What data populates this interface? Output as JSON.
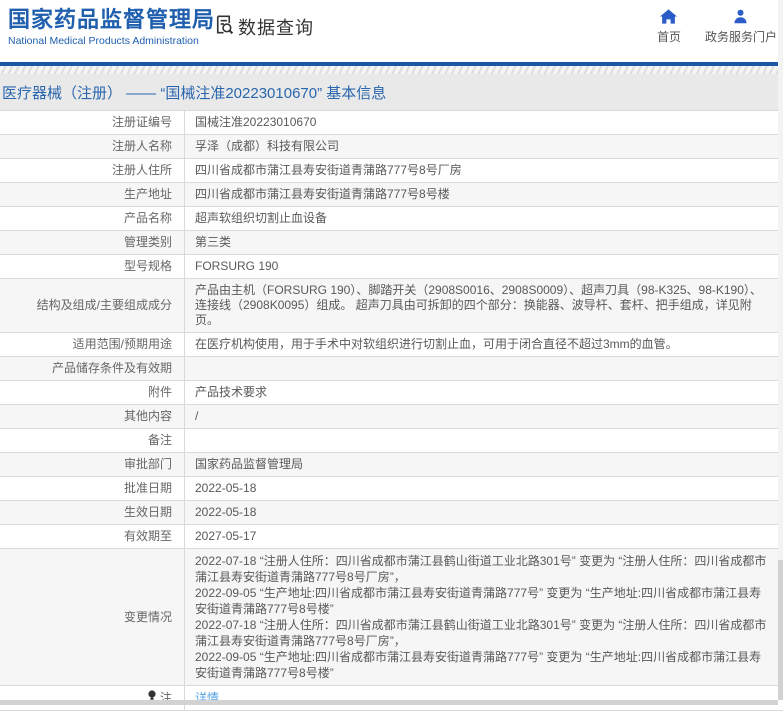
{
  "header": {
    "org_name": "国家药品监督管理局",
    "org_name_en": "National Medical Products Administration",
    "app_title": "数据查询",
    "nav": [
      {
        "label": "首页",
        "icon": "home-icon"
      },
      {
        "label": "政务服务门户",
        "icon": "user-icon"
      }
    ]
  },
  "breadcrumb": "医疗器械（注册） —— “国械注准20223010670” 基本信息",
  "colors": {
    "brand_blue": "#1f5fae",
    "bar_blue": "#1c57a5",
    "nav_icon_blue": "#2b5cc8",
    "link_blue": "#55a2e6",
    "breadcrumb_text": "#2a66ad"
  },
  "table": {
    "rows": [
      {
        "label": "注册证编号",
        "value": "国械注准20223010670"
      },
      {
        "label": "注册人名称",
        "value": "孚泽（成都）科技有限公司"
      },
      {
        "label": "注册人住所",
        "value": "四川省成都市蒲江县寿安街道青蒲路777号8号厂房"
      },
      {
        "label": "生产地址",
        "value": "四川省成都市蒲江县寿安街道青蒲路777号8号楼"
      },
      {
        "label": "产品名称",
        "value": "超声软组织切割止血设备"
      },
      {
        "label": "管理类别",
        "value": "第三类"
      },
      {
        "label": "型号规格",
        "value": "FORSURG 190"
      },
      {
        "label": "结构及组成/主要组成成分",
        "value": "产品由主机（FORSURG 190）、脚踏开关（2908S0016、2908S0009）、超声刀具（98-K325、98-K190）、连接线（2908K0095）组成。 超声刀具由可拆卸的四个部分：换能器、波导杆、套杆、把手组成，详见附页。"
      },
      {
        "label": "适用范围/预期用途",
        "value": "在医疗机构使用，用于手术中对软组织进行切割止血，可用于闭合直径不超过3mm的血管。"
      },
      {
        "label": "产品储存条件及有效期",
        "value": ""
      },
      {
        "label": "附件",
        "value": "产品技术要求"
      },
      {
        "label": "其他内容",
        "value": "/"
      },
      {
        "label": "备注",
        "value": ""
      },
      {
        "label": "审批部门",
        "value": "国家药品监督管理局"
      },
      {
        "label": "批准日期",
        "value": "2022-05-18"
      },
      {
        "label": "生效日期",
        "value": "2022-05-18"
      },
      {
        "label": "有效期至",
        "value": "2027-05-17"
      },
      {
        "label": "变更情况",
        "lines": [
          "2022-07-18 “注册人住所：四川省成都市蒲江县鹤山街道工业北路301号” 变更为 “注册人住所：四川省成都市蒲江县寿安街道青蒲路777号8号厂房”，",
          "2022-09-05 “生产地址:四川省成都市蒲江县寿安街道青蒲路777号” 变更为 “生产地址:四川省成都市蒲江县寿安街道青蒲路777号8号楼”",
          "2022-07-18 “注册人住所：四川省成都市蒲江县鹤山街道工业北路301号” 变更为 “注册人住所：四川省成都市蒲江县寿安街道青蒲路777号8号厂房”，",
          "2022-09-05 “生产地址:四川省成都市蒲江县寿安街道青蒲路777号” 变更为 “生产地址:四川省成都市蒲江县寿安街道青蒲路777号8号楼”"
        ]
      },
      {
        "label": "注",
        "icon": "bulb",
        "link": "详情"
      }
    ]
  }
}
